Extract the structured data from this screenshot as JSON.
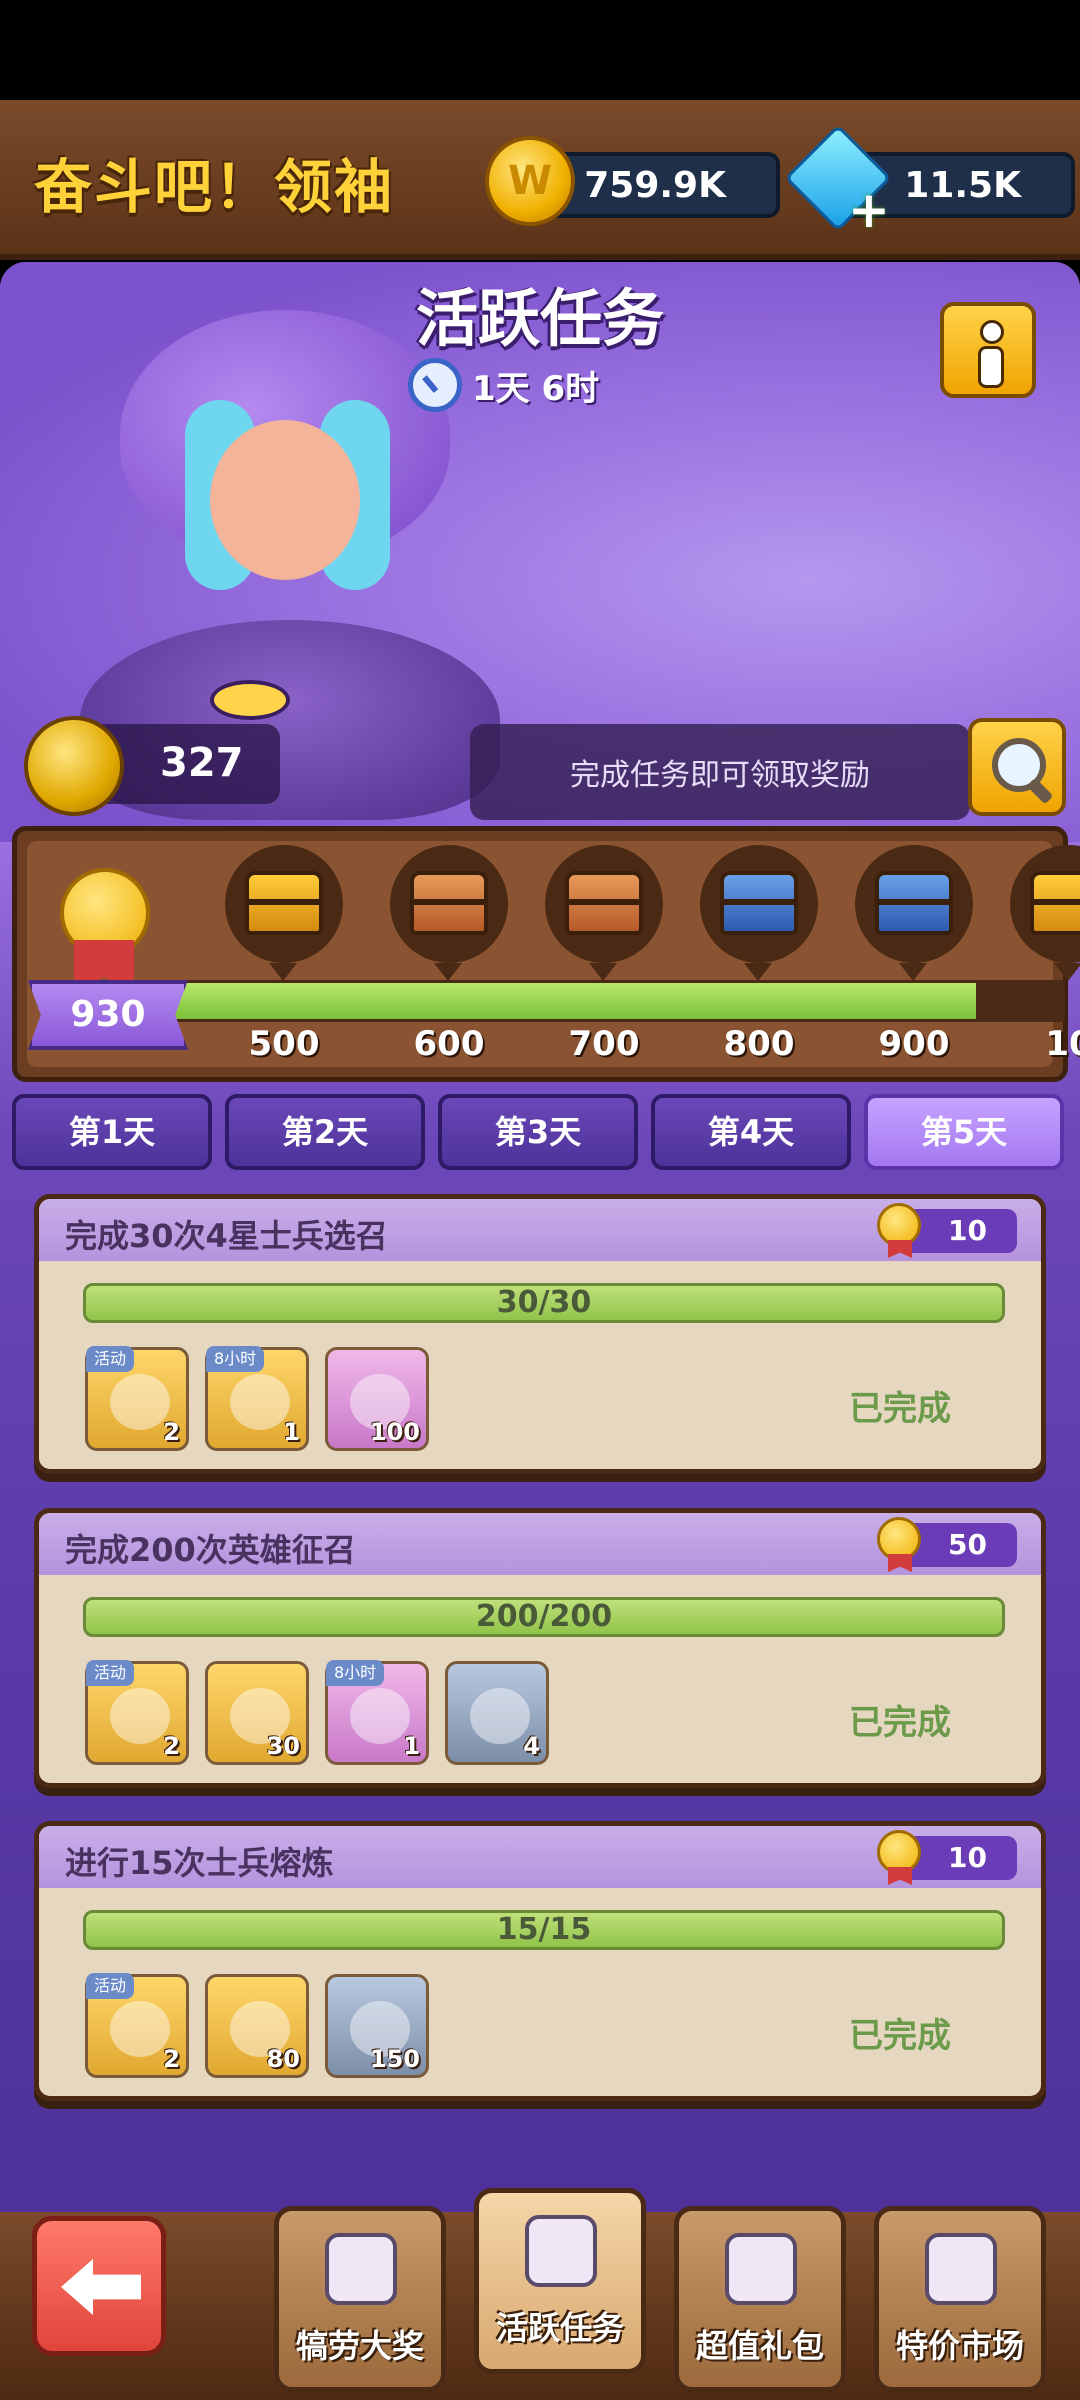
{
  "header": {
    "title": "奋斗吧！领袖",
    "coins": "759.9K",
    "gems": "11.5K"
  },
  "event": {
    "title": "活跃任务",
    "timer": "1天 6时",
    "points": "327",
    "hint": "完成任务即可领取奖励"
  },
  "track": {
    "current_score": "930",
    "progress_fraction": 0.9,
    "milestones": [
      "500",
      "600",
      "700",
      "800",
      "900",
      "10"
    ],
    "chest_types": [
      "gold",
      "bronze",
      "bronze",
      "blue",
      "blue",
      "gold"
    ]
  },
  "tabs": [
    "第1天",
    "第2天",
    "第3天",
    "第4天",
    "第5天"
  ],
  "active_tab": 4,
  "tasks": [
    {
      "title": "完成30次4星士兵选召",
      "reward": "10",
      "progress": "30/30",
      "status": "已完成",
      "items": [
        {
          "tag": "活动",
          "qty": "2",
          "style": "gold"
        },
        {
          "tag": "8小时",
          "qty": "1",
          "style": "gold"
        },
        {
          "tag": "",
          "qty": "100",
          "style": "pink"
        }
      ]
    },
    {
      "title": "完成200次英雄征召",
      "reward": "50",
      "progress": "200/200",
      "status": "已完成",
      "items": [
        {
          "tag": "活动",
          "qty": "2",
          "style": "gold"
        },
        {
          "tag": "",
          "qty": "30",
          "style": "gold"
        },
        {
          "tag": "8小时",
          "qty": "1",
          "style": "pink"
        },
        {
          "tag": "",
          "qty": "4",
          "style": "steel"
        }
      ]
    },
    {
      "title": "进行15次士兵熔炼",
      "reward": "10",
      "progress": "15/15",
      "status": "已完成",
      "items": [
        {
          "tag": "活动",
          "qty": "2",
          "style": "gold"
        },
        {
          "tag": "",
          "qty": "80",
          "style": "gold"
        },
        {
          "tag": "",
          "qty": "150",
          "style": "steel"
        }
      ]
    }
  ],
  "bottom_nav": [
    "犒劳大奖",
    "活跃任务",
    "超值礼包",
    "特价市场"
  ],
  "bottom_nav_active": 1
}
